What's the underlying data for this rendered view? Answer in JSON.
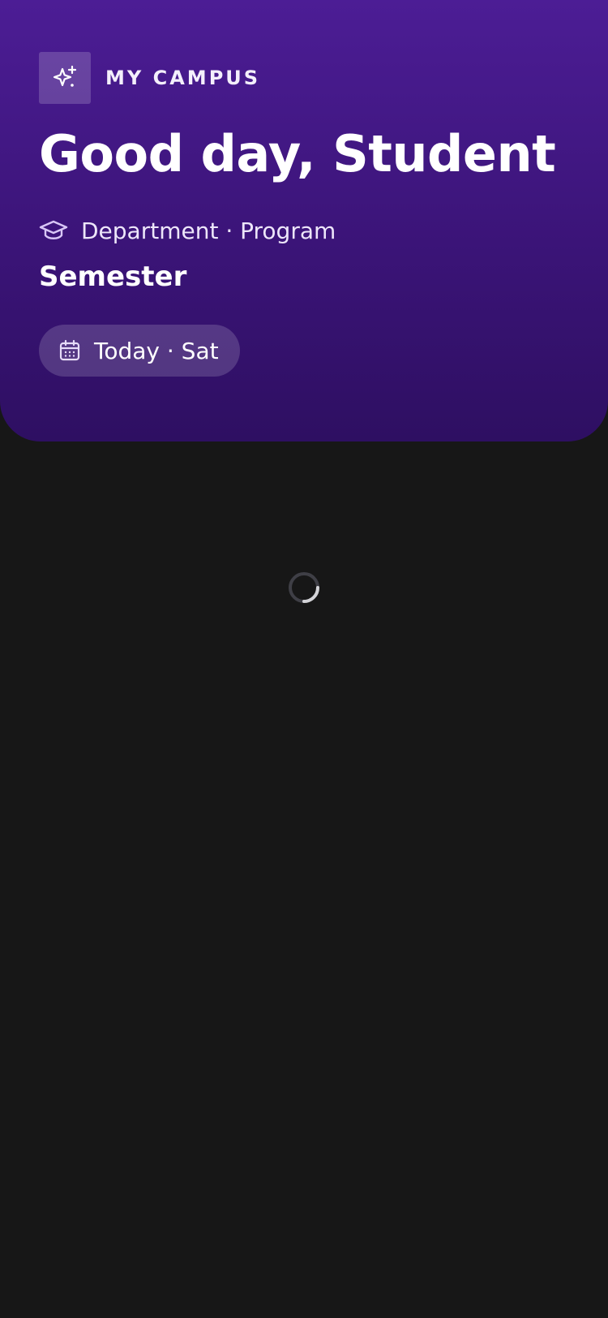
{
  "brand": {
    "label": "MY CAMPUS",
    "icon": "sparkles-icon"
  },
  "greeting": "Good day, Student",
  "profile": {
    "department_program": "Department · Program",
    "department_icon": "graduation-cap-icon",
    "semester": "Semester"
  },
  "date_chip": {
    "label": "Today · Sat",
    "icon": "calendar-icon"
  },
  "loading": {
    "icon": "loading-spinner-icon"
  },
  "colors": {
    "header_top": "#4c1d95",
    "header_bottom": "#2e0f62",
    "background": "#171717",
    "text": "#ffffff"
  }
}
